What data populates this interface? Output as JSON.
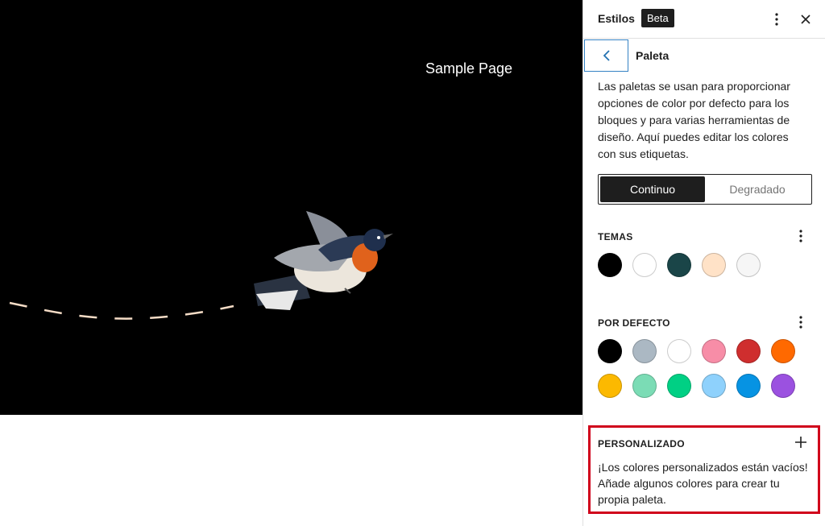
{
  "canvas": {
    "nav_link": "Sample Page"
  },
  "sidebar": {
    "title": "Estilos",
    "badge": "Beta",
    "more_icon": "more-vertical-icon",
    "close_icon": "close-icon",
    "back_icon": "chevron-left-icon",
    "subtitle": "Paleta",
    "description": "Las paletas se usan para proporcionar opciones de color por defecto para los bloques y para varias herramientas de diseño. Aquí puedes editar los colores con sus etiquetas.",
    "tabs": [
      {
        "label": "Continuo",
        "active": true
      },
      {
        "label": "Degradado",
        "active": false
      }
    ],
    "theme": {
      "label": "TEMAS",
      "colors": [
        "#000000",
        "#ffffff",
        "#1a4548",
        "#ffe2c7",
        "#f6f6f6"
      ]
    },
    "default": {
      "label": "POR DEFECTO",
      "colors": [
        "#000000",
        "#abb8c3",
        "#ffffff",
        "#f78da7",
        "#cf2e2e",
        "#ff6900",
        "#fcb900",
        "#7bdcb5",
        "#00d084",
        "#8ed1fc",
        "#0693e3",
        "#9b51e0"
      ]
    },
    "custom": {
      "label": "PERSONALIZADO",
      "add_icon": "plus-icon",
      "empty_text": "¡Los colores personalizados están vacíos! Añade algunos colores para crear tu propia paleta.",
      "highlight_color": "#d0021b"
    }
  }
}
